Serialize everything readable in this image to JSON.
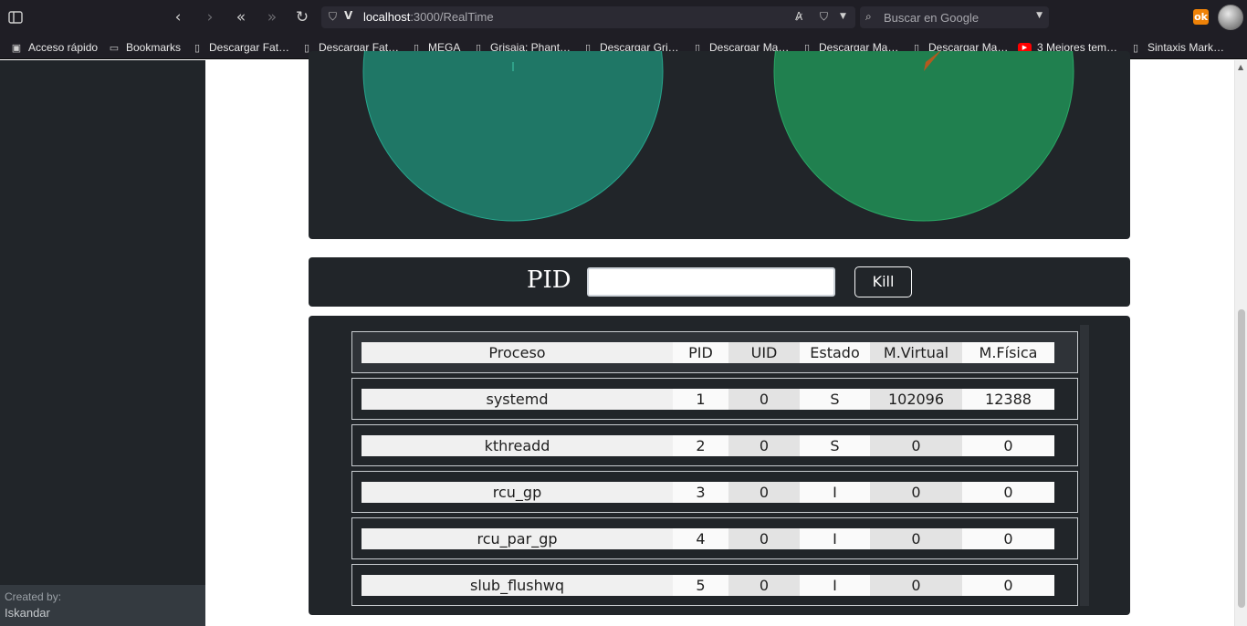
{
  "browser": {
    "url_host": "localhost",
    "url_path": ":3000/RealTime",
    "search_placeholder": "Buscar en Google",
    "bookmarks": [
      {
        "label": "Acceso rápido",
        "icon": "quick-access-icon"
      },
      {
        "label": "Bookmarks",
        "icon": "folder-icon"
      },
      {
        "label": "Descargar Fat…",
        "icon": "page-icon"
      },
      {
        "label": "Descargar Fat…",
        "icon": "page-icon"
      },
      {
        "label": "MEGA",
        "icon": "page-icon"
      },
      {
        "label": "Grisaia: Phant…",
        "icon": "page-icon"
      },
      {
        "label": "Descargar Gri…",
        "icon": "page-icon"
      },
      {
        "label": "Descargar Ma…",
        "icon": "page-icon"
      },
      {
        "label": "Descargar Ma…",
        "icon": "page-icon"
      },
      {
        "label": "Descargar Ma…",
        "icon": "page-icon"
      },
      {
        "label": "3 Mejores tem…",
        "icon": "youtube-icon"
      },
      {
        "label": "Sintaxis Mark…",
        "icon": "page-icon"
      }
    ]
  },
  "sidebar": {
    "credit_label": "Created by:",
    "credit_name": "Iskandar"
  },
  "charts": {
    "colors": {
      "left_pie": "#1f7766",
      "right_pie": "#20804f",
      "slice_accent": "#b35a1f"
    }
  },
  "kill_form": {
    "label": "PID",
    "input_value": "",
    "button_label": "Kill"
  },
  "processes": {
    "headers": [
      "Proceso",
      "PID",
      "UID",
      "Estado",
      "M.Virtual",
      "M.Física"
    ],
    "rows": [
      [
        "systemd",
        "1",
        "0",
        "S",
        "102096",
        "12388"
      ],
      [
        "kthreadd",
        "2",
        "0",
        "S",
        "0",
        "0"
      ],
      [
        "rcu_gp",
        "3",
        "0",
        "I",
        "0",
        "0"
      ],
      [
        "rcu_par_gp",
        "4",
        "0",
        "I",
        "0",
        "0"
      ],
      [
        "slub_flushwq",
        "5",
        "0",
        "I",
        "0",
        "0"
      ]
    ]
  }
}
